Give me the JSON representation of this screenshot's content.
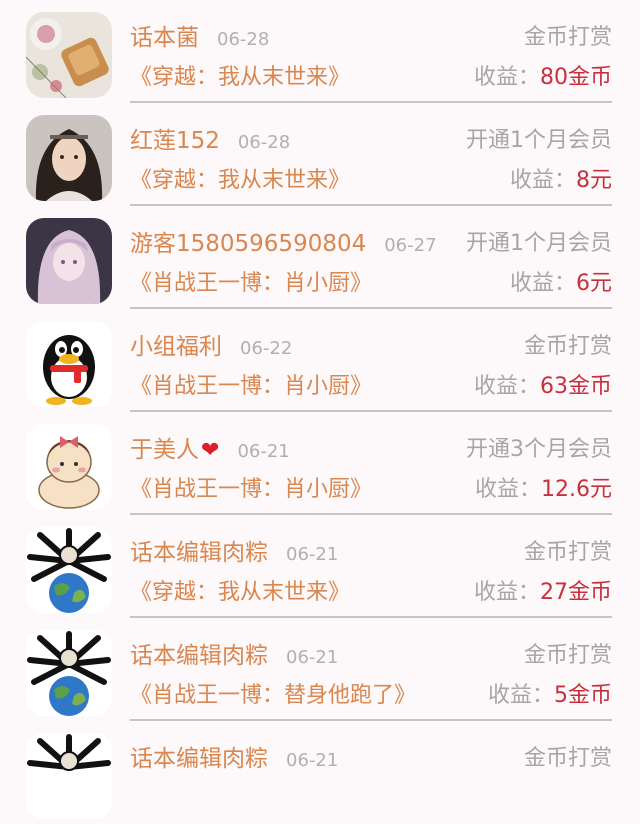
{
  "items": [
    {
      "name": "话本菌",
      "date": "06-28",
      "type": "金币打赏",
      "book": "《穿越：我从末世来》",
      "earn_label": "收益：",
      "earn_value": "80金币",
      "avatar": "food-photo"
    },
    {
      "name": "红莲152",
      "date": "06-28",
      "type": "开通1个月会员",
      "book": "《穿越：我从末世来》",
      "earn_label": "收益：",
      "earn_value": "8元",
      "avatar": "man-portrait"
    },
    {
      "name": "游客1580596590804",
      "date": "06-27",
      "type": "开通1个月会员",
      "book": "《肖战王一博：肖小厨》",
      "earn_label": "收益：",
      "earn_value": "6元",
      "avatar": "anime-girl"
    },
    {
      "name": "小组福利",
      "date": "06-22",
      "type": "金币打赏",
      "book": "《肖战王一博：肖小厨》",
      "earn_label": "收益：",
      "earn_value": "63金币",
      "avatar": "penguin"
    },
    {
      "name": "于美人",
      "heart": "❤",
      "date": "06-21",
      "type": "开通3个月会员",
      "book": "《肖战王一博：肖小厨》",
      "earn_label": "收益：",
      "earn_value": "12.6元",
      "avatar": "cartoon-girl"
    },
    {
      "name": "话本编辑肉粽",
      "date": "06-21",
      "type": "金币打赏",
      "book": "《穿越：我从末世来》",
      "earn_label": "收益：",
      "earn_value": "27金币",
      "avatar": "earth-spider"
    },
    {
      "name": "话本编辑肉粽",
      "date": "06-21",
      "type": "金币打赏",
      "book": "《肖战王一博：替身他跑了》",
      "earn_label": "收益：",
      "earn_value": "5金币",
      "avatar": "earth-spider"
    },
    {
      "name": "话本编辑肉粽",
      "date": "06-21",
      "type": "金币打赏",
      "book": "",
      "earn_label": "",
      "earn_value": "",
      "avatar": "earth-spider"
    }
  ],
  "colors": {
    "name": "#d9874f",
    "muted": "#a9a4a6",
    "value": "#c9303d"
  }
}
